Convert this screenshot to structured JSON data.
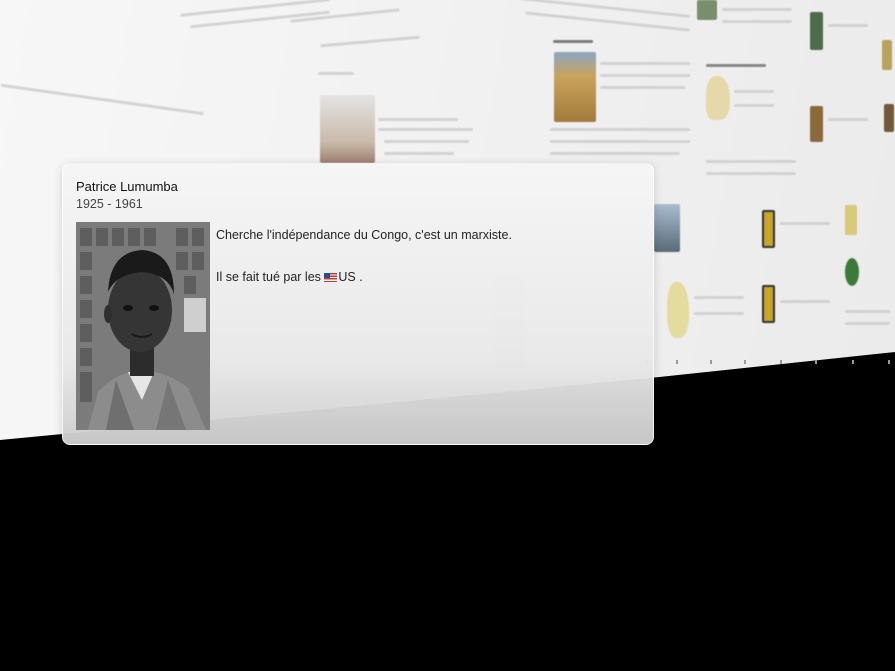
{
  "popup": {
    "name": "Patrice Lumumba",
    "dates": "1925 - 1961",
    "line1": "Cherche l'indépendance du Congo, c'est un marxiste.",
    "line2_prefix": "Il se fait tué par les ",
    "line2_flag_icon": "us-flag-icon",
    "line2_country": "US",
    "line2_suffix": " ."
  },
  "colors": {
    "popup_bg": "#efefef",
    "page_bg": "#f4f4f4",
    "backdrop": "#000000"
  }
}
